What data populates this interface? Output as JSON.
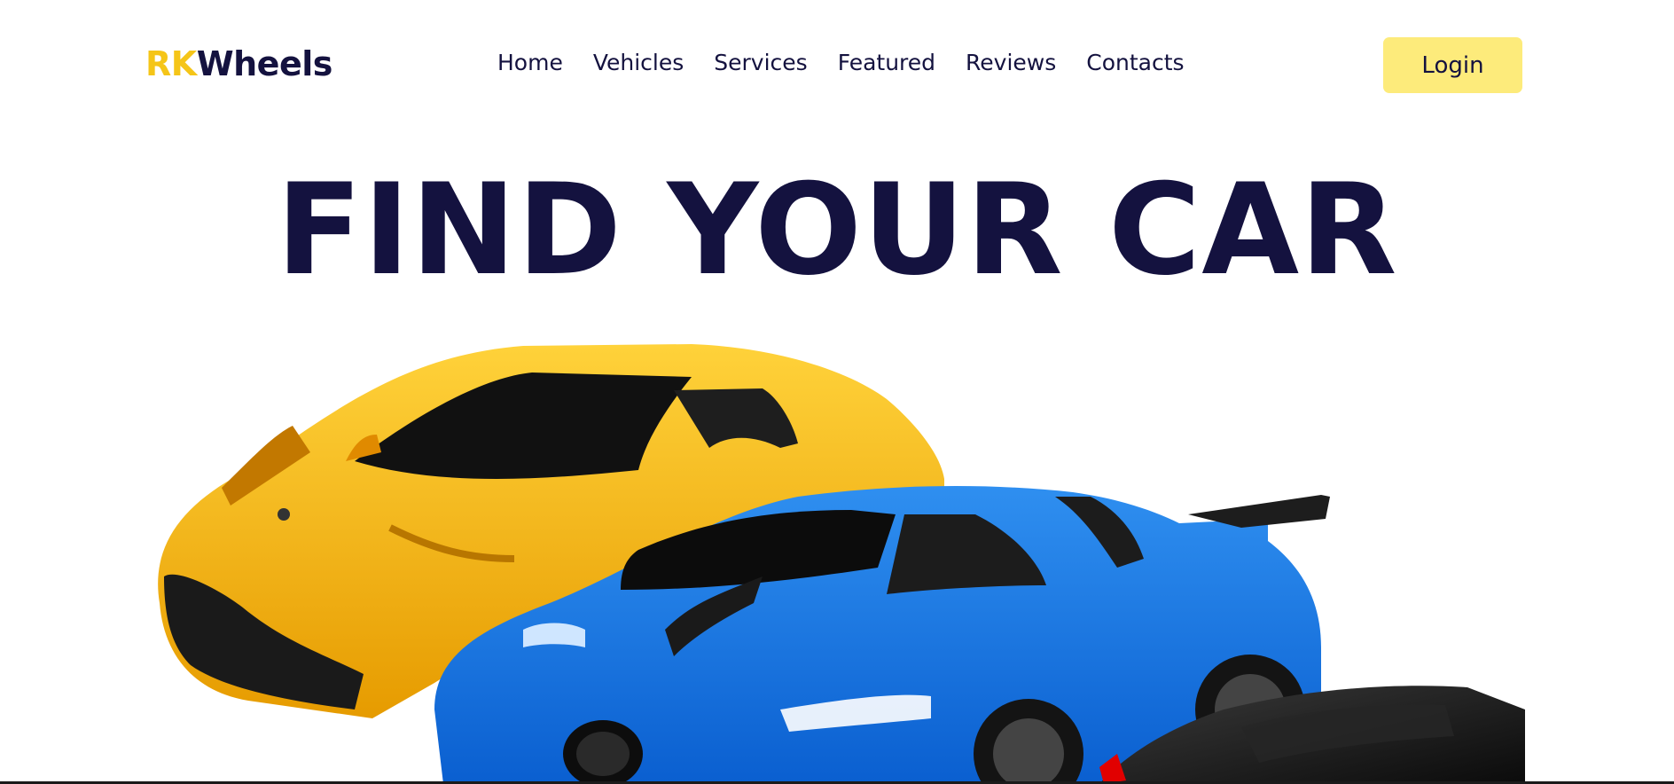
{
  "brand": {
    "part1": "RK",
    "part2": "Wheels"
  },
  "nav": {
    "items": [
      "Home",
      "Vehicles",
      "Services",
      "Featured",
      "Reviews",
      "Contacts"
    ]
  },
  "login_label": "Login",
  "hero": {
    "title": "FIND YOUR CAR"
  },
  "colors": {
    "accent": "#f5c518",
    "dark": "#14123f",
    "button": "#fdeb7b"
  }
}
